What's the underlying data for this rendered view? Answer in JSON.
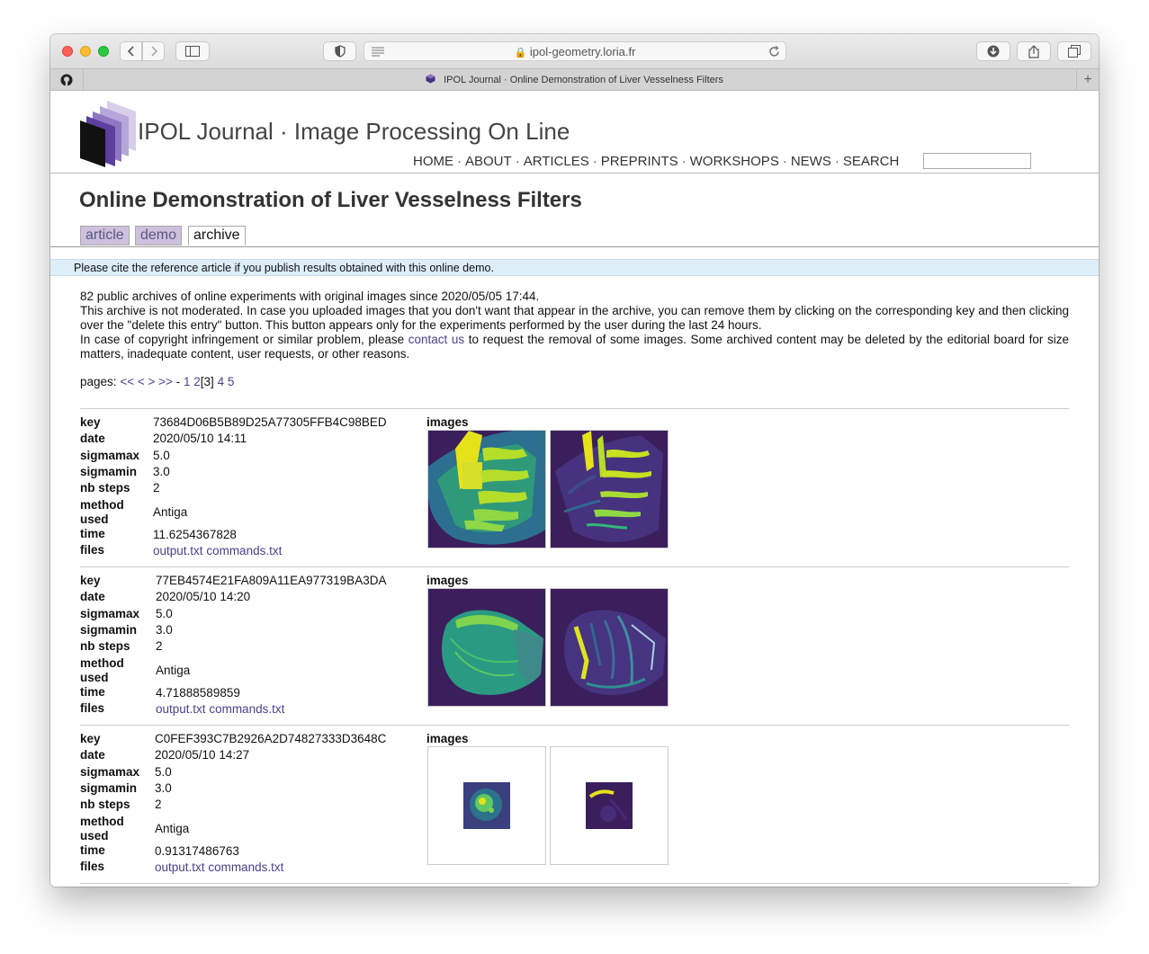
{
  "browser": {
    "url": "ipol-geometry.loria.fr",
    "tab_title": "IPOL Journal · Online Demonstration of Liver Vesselness Filters"
  },
  "site": {
    "title": "IPOL Journal · Image Processing On Line",
    "nav": [
      "HOME",
      "ABOUT",
      "ARTICLES",
      "PREPRINTS",
      "WORKSHOPS",
      "NEWS",
      "SEARCH"
    ]
  },
  "page": {
    "title": "Online Demonstration of Liver Vesselness Filters",
    "tabs": [
      "article",
      "demo",
      "archive"
    ],
    "cite_notice": "Please cite the reference article if you publish results obtained with this online demo.",
    "intro": {
      "line1": "82 public archives of online experiments with original images since 2020/05/05 17:44.",
      "line2": "This archive is not moderated. In case you uploaded images that you don't want that appear in the archive, you can remove them by clicking on the corresponding key and then clicking over the \"delete this entry\" button. This button appears only for the experiments performed by the user during the last 24 hours.",
      "line3_before": "In case of copyright infringement or similar problem, please",
      "contact_link": "contact us",
      "line3_after": "to request the removal of some images. Some archived content may be deleted by the editorial board for size matters, inadequate content, user requests, or other reasons."
    },
    "pagination": {
      "label": "pages:",
      "first": "<<",
      "prev": "<",
      "next": ">",
      "last": ">>",
      "dash": "-",
      "p1": "1",
      "p2": "2",
      "current": "[3]",
      "p4": "4",
      "p5": "5"
    }
  },
  "labels": {
    "key": "key",
    "date": "date",
    "sigmamax": "sigmamax",
    "sigmamin": "sigmamin",
    "nb_steps": "nb steps",
    "method_used": "method used",
    "time": "time",
    "files": "files",
    "images": "images"
  },
  "entries": [
    {
      "key": "73684D06B5B89D25A77305FFB4C98BED",
      "date": "2020/05/10 14:11",
      "sigmamax": "5.0",
      "sigmamin": "3.0",
      "nb_steps": "2",
      "method_used": "Antiga",
      "time": "11.6254367828",
      "file1": "output.txt",
      "file2": "commands.txt"
    },
    {
      "key": "77EB4574E21FA809A11EA977319BA3DA",
      "date": "2020/05/10 14:20",
      "sigmamax": "5.0",
      "sigmamin": "3.0",
      "nb_steps": "2",
      "method_used": "Antiga",
      "time": "4.71888589859",
      "file1": "output.txt",
      "file2": "commands.txt"
    },
    {
      "key": "C0FEF393C7B2926A2D74827333D3648C",
      "date": "2020/05/10 14:27",
      "sigmamax": "5.0",
      "sigmamin": "3.0",
      "nb_steps": "2",
      "method_used": "Antiga",
      "time": "0.91317486763",
      "file1": "output.txt",
      "file2": "commands.txt"
    }
  ],
  "colors": {
    "link": "#4b3f8c",
    "viridis_dark": "#3b1f5c",
    "viridis_green": "#2f9a7a",
    "viridis_yellow": "#e6e21a",
    "cite_bg": "#ddeef9",
    "tab_inactive_bg": "#cdc0dd"
  }
}
